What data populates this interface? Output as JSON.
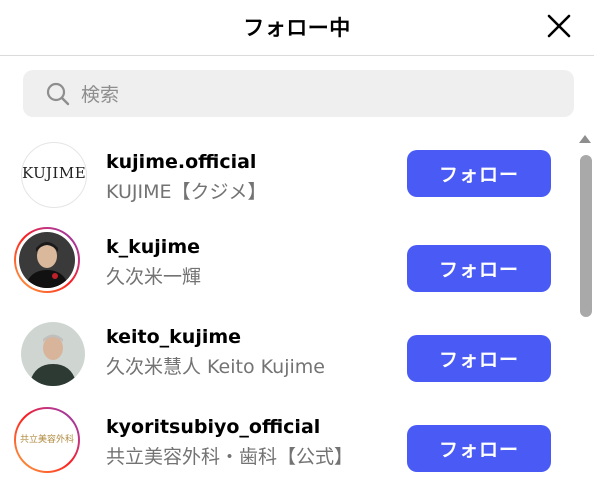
{
  "header": {
    "title": "フォロー中"
  },
  "search": {
    "placeholder": "検索",
    "value": ""
  },
  "users": [
    {
      "username": "kujime.official",
      "fullname": "KUJIME【クジメ】",
      "button": "フォロー",
      "avatar_text": "KUJIME",
      "story_ring": false
    },
    {
      "username": "k_kujime",
      "fullname": "久次米一輝",
      "button": "フォロー",
      "story_ring": true
    },
    {
      "username": "keito_kujime",
      "fullname": "久次米慧人 Keito Kujime",
      "button": "フォロー",
      "story_ring": false
    },
    {
      "username": "kyoritsubiyo_official",
      "fullname": "共立美容外科・歯科【公式】",
      "button": "フォロー",
      "avatar_text": "共立美容外科",
      "story_ring": true
    }
  ],
  "colors": {
    "follow_button": "#4a5bf5",
    "secondary_text": "#737373",
    "search_bg": "#efefef"
  }
}
